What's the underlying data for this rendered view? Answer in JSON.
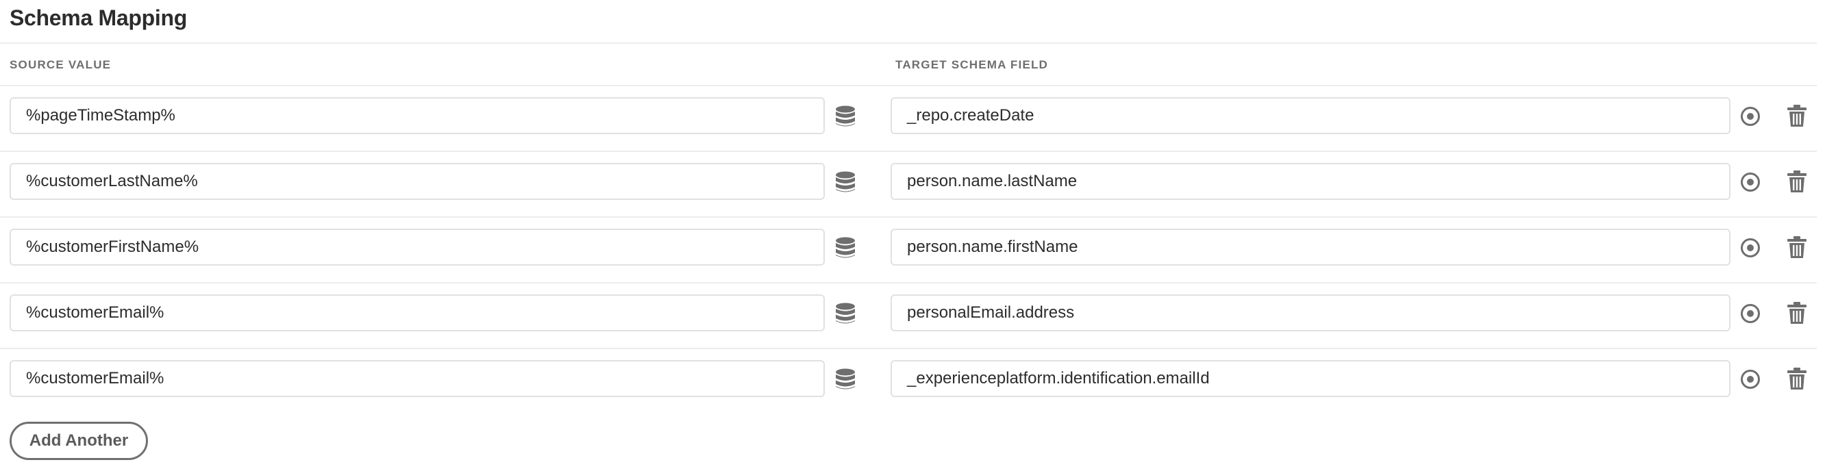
{
  "section": {
    "title": "Schema Mapping"
  },
  "columns": {
    "source_header": "Source Value",
    "target_header": "Target Schema Field"
  },
  "mappings": [
    {
      "source": "%pageTimeStamp%",
      "target": "_repo.createDate"
    },
    {
      "source": "%customerLastName%",
      "target": "person.name.lastName"
    },
    {
      "source": "%customerFirstName%",
      "target": "person.name.firstName"
    },
    {
      "source": "%customerEmail%",
      "target": "personalEmail.address"
    },
    {
      "source": "%customerEmail%",
      "target": "_experienceplatform.identification.emailId"
    }
  ],
  "row_icons": {
    "source_picker": "database-icon",
    "target_picker": "target-icon",
    "remove": "trash-icon"
  },
  "actions": {
    "add_label": "Add Another"
  },
  "colors": {
    "text": "#2c2c2c",
    "muted": "#6e6e6e",
    "icon": "#6e6e6e",
    "border": "#e1e1e1",
    "divider": "#ececec",
    "button_border": "#707070"
  }
}
